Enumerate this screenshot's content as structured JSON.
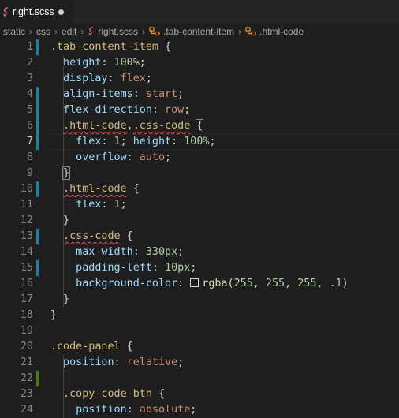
{
  "tab": {
    "label": "right.scss",
    "icon": "sass-file-icon"
  },
  "breadcrumb": [
    {
      "label": "static",
      "icon": ""
    },
    {
      "label": "css",
      "icon": ""
    },
    {
      "label": "edit",
      "icon": ""
    },
    {
      "label": "right.scss",
      "icon": "sass-file-icon"
    },
    {
      "label": ".tab-content-item",
      "icon": "symbol-class-icon"
    },
    {
      "label": ".html-code",
      "icon": "symbol-class-icon"
    }
  ],
  "colors": {
    "gutter_modified": "#1b81a8",
    "gutter_added": "#487e02",
    "selector": "#d7ba7d",
    "property": "#9cdcfe",
    "value": "#ce9178",
    "number": "#b5cea8",
    "function": "#dcdcaa"
  },
  "current_line": 7,
  "lines": [
    {
      "n": 1,
      "mark": "modified",
      "tokens": [
        [
          "sel",
          "  .tab-content-item"
        ],
        [
          "p",
          " {"
        ]
      ]
    },
    {
      "n": 2,
      "mark": "",
      "tokens": [
        [
          "p",
          "    "
        ],
        [
          "prop",
          "height"
        ],
        [
          "p",
          ": "
        ],
        [
          "num",
          "100%"
        ],
        [
          "p",
          ";"
        ]
      ]
    },
    {
      "n": 3,
      "mark": "",
      "tokens": [
        [
          "p",
          "    "
        ],
        [
          "prop",
          "display"
        ],
        [
          "p",
          ": "
        ],
        [
          "val",
          "flex"
        ],
        [
          "p",
          ";"
        ]
      ]
    },
    {
      "n": 4,
      "mark": "modified",
      "tokens": [
        [
          "p",
          "    "
        ],
        [
          "prop",
          "align-items"
        ],
        [
          "p",
          ": "
        ],
        [
          "val",
          "start"
        ],
        [
          "p",
          ";"
        ]
      ]
    },
    {
      "n": 5,
      "mark": "modified",
      "tokens": [
        [
          "p",
          "    "
        ],
        [
          "prop",
          "flex-direction"
        ],
        [
          "p",
          ": "
        ],
        [
          "val",
          "row"
        ],
        [
          "p",
          ";"
        ]
      ]
    },
    {
      "n": 6,
      "mark": "modified",
      "tokens": [
        [
          "p",
          "    "
        ],
        [
          "sel-sq",
          ".html-code"
        ],
        [
          "p",
          ","
        ],
        [
          "sel-sq",
          ".css-code"
        ],
        [
          "p",
          " "
        ],
        [
          "bm",
          "{"
        ]
      ]
    },
    {
      "n": 7,
      "mark": "modified",
      "tokens": [
        [
          "p",
          "      "
        ],
        [
          "prop",
          "flex"
        ],
        [
          "p",
          ": "
        ],
        [
          "num",
          "1"
        ],
        [
          "p",
          "; "
        ],
        [
          "prop",
          "height"
        ],
        [
          "p",
          ": "
        ],
        [
          "num",
          "100%"
        ],
        [
          "p",
          ";"
        ]
      ]
    },
    {
      "n": 8,
      "mark": "",
      "tokens": [
        [
          "p",
          "      "
        ],
        [
          "prop",
          "overflow"
        ],
        [
          "p",
          ": "
        ],
        [
          "val",
          "auto"
        ],
        [
          "p",
          ";"
        ]
      ]
    },
    {
      "n": 9,
      "mark": "",
      "tokens": [
        [
          "p",
          "    "
        ],
        [
          "bm",
          "}"
        ]
      ]
    },
    {
      "n": 10,
      "mark": "modified",
      "tokens": [
        [
          "p",
          "    "
        ],
        [
          "sel-sq",
          ".html-code"
        ],
        [
          "p",
          " {"
        ]
      ]
    },
    {
      "n": 11,
      "mark": "",
      "tokens": [
        [
          "p",
          "      "
        ],
        [
          "prop",
          "flex"
        ],
        [
          "p",
          ": "
        ],
        [
          "num",
          "1"
        ],
        [
          "p",
          ";"
        ]
      ]
    },
    {
      "n": 12,
      "mark": "",
      "tokens": [
        [
          "p",
          "    }"
        ]
      ]
    },
    {
      "n": 13,
      "mark": "modified",
      "tokens": [
        [
          "p",
          "    "
        ],
        [
          "sel-sq",
          ".css-code"
        ],
        [
          "p",
          " {"
        ]
      ]
    },
    {
      "n": 14,
      "mark": "",
      "tokens": [
        [
          "p",
          "      "
        ],
        [
          "prop",
          "max-width"
        ],
        [
          "p",
          ": "
        ],
        [
          "num",
          "330px"
        ],
        [
          "p",
          ";"
        ]
      ]
    },
    {
      "n": 15,
      "mark": "modified",
      "tokens": [
        [
          "p",
          "      "
        ],
        [
          "prop",
          "padding-left"
        ],
        [
          "p",
          ": "
        ],
        [
          "num",
          "10px"
        ],
        [
          "p",
          ";"
        ]
      ]
    },
    {
      "n": 16,
      "mark": "",
      "tokens": [
        [
          "p",
          "      "
        ],
        [
          "prop",
          "background-color"
        ],
        [
          "p",
          ": "
        ],
        [
          "sw",
          ""
        ],
        [
          "fn",
          "rgba"
        ],
        [
          "p",
          "("
        ],
        [
          "num",
          "255"
        ],
        [
          "p",
          ", "
        ],
        [
          "num",
          "255"
        ],
        [
          "p",
          ", "
        ],
        [
          "num",
          "255"
        ],
        [
          "p",
          ", "
        ],
        [
          "num",
          ".1"
        ],
        [
          "p",
          ")"
        ]
      ]
    },
    {
      "n": 17,
      "mark": "",
      "tokens": [
        [
          "p",
          "    }"
        ]
      ]
    },
    {
      "n": 18,
      "mark": "",
      "tokens": [
        [
          "p",
          "  }"
        ]
      ]
    },
    {
      "n": 19,
      "mark": "",
      "tokens": []
    },
    {
      "n": 20,
      "mark": "",
      "tokens": [
        [
          "sel",
          "  .code-panel"
        ],
        [
          "p",
          " {"
        ]
      ]
    },
    {
      "n": 21,
      "mark": "",
      "tokens": [
        [
          "p",
          "    "
        ],
        [
          "prop",
          "position"
        ],
        [
          "p",
          ": "
        ],
        [
          "val",
          "relative"
        ],
        [
          "p",
          ";"
        ]
      ]
    },
    {
      "n": 22,
      "mark": "added",
      "tokens": []
    },
    {
      "n": 23,
      "mark": "",
      "tokens": [
        [
          "p",
          "    "
        ],
        [
          "sel",
          ".copy-code-btn"
        ],
        [
          "p",
          " {"
        ]
      ]
    },
    {
      "n": 24,
      "mark": "",
      "tokens": [
        [
          "p",
          "      "
        ],
        [
          "prop",
          "position"
        ],
        [
          "p",
          ": "
        ],
        [
          "val",
          "absolute"
        ],
        [
          "p",
          ";"
        ]
      ]
    }
  ]
}
